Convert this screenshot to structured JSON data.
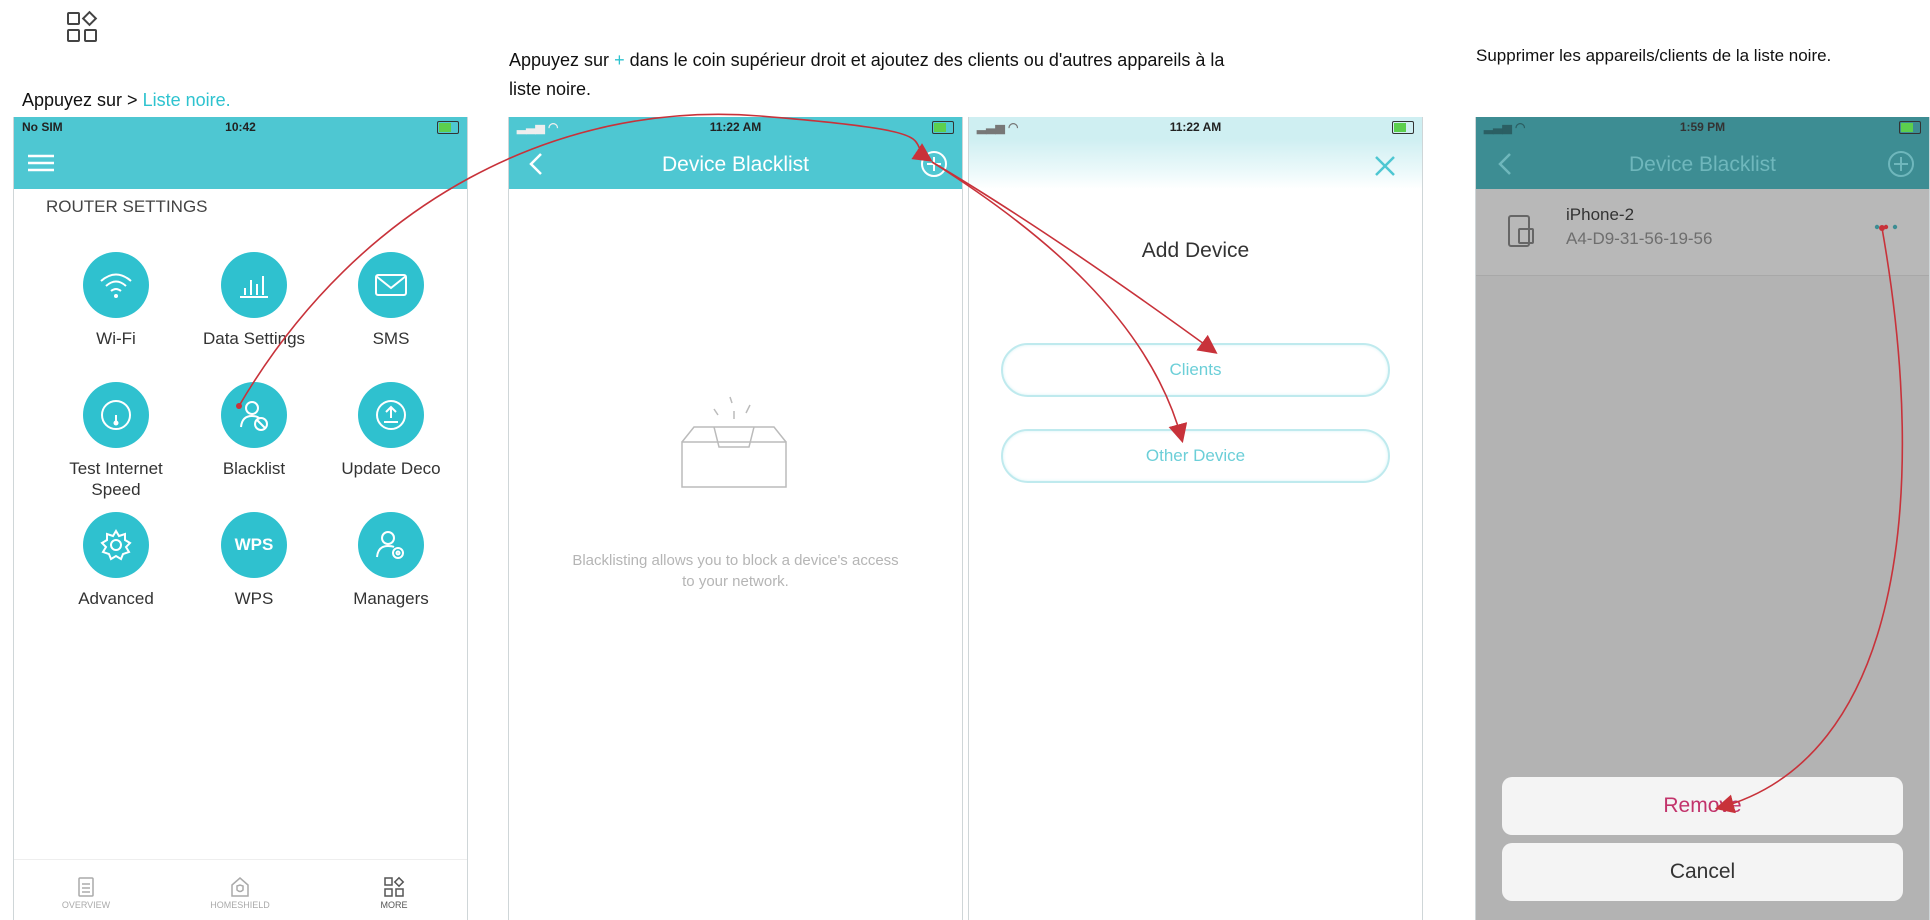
{
  "top_icon": "apps-grid-icon",
  "captions": {
    "step1_prefix": "Appuyez sur > ",
    "step1_link": "Liste noire.",
    "step2_line1_a": "Appuyez sur ",
    "step2_plus": "+",
    "step2_line1_b": " dans le coin supérieur droit et ajoutez des clients ou d'autres appareils à la",
    "step2_line2": "liste noire.",
    "step3": "Supprimer les appareils/clients de la liste noire."
  },
  "phone1": {
    "status_left": "No SIM",
    "status_time": "10:42",
    "section_title": "ROUTER SETTINGS",
    "tiles": [
      {
        "label": "Wi-Fi",
        "icon": "wifi-icon"
      },
      {
        "label": "Data Settings",
        "icon": "bar-chart-icon"
      },
      {
        "label": "SMS",
        "icon": "envelope-icon"
      },
      {
        "label": "Test Internet Speed",
        "icon": "speedometer-icon"
      },
      {
        "label": "Blacklist",
        "icon": "blacklist-user-icon"
      },
      {
        "label": "Update Deco",
        "icon": "upload-icon"
      },
      {
        "label": "Advanced",
        "icon": "gear-icon"
      },
      {
        "label": "WPS",
        "icon": "wps-icon"
      },
      {
        "label": "Managers",
        "icon": "user-gear-icon"
      }
    ],
    "wps_text": "WPS",
    "tabs": [
      {
        "label": "OVERVIEW",
        "icon": "document-icon"
      },
      {
        "label": "HOMESHIELD",
        "icon": "shield-home-icon"
      },
      {
        "label": "MORE",
        "icon": "apps-grid-icon"
      }
    ]
  },
  "phone2": {
    "status_time": "11:22 AM",
    "title": "Device Blacklist",
    "empty_text": "Blacklisting allows you to block a device's access to your network."
  },
  "phone3": {
    "status_time": "11:22 AM",
    "title": "Add Device",
    "buttons": [
      "Clients",
      "Other Device"
    ]
  },
  "phone4": {
    "status_time": "1:59 PM",
    "title": "Device Blacklist",
    "device_name": "iPhone-2",
    "device_mac": "A4-D9-31-56-19-56",
    "remove_label": "Remove",
    "cancel_label": "Cancel"
  },
  "colors": {
    "accent": "#2ec3cf",
    "header_teal": "#4ec7d2",
    "remove_text": "#c2336b",
    "arrow": "#c8323a"
  }
}
